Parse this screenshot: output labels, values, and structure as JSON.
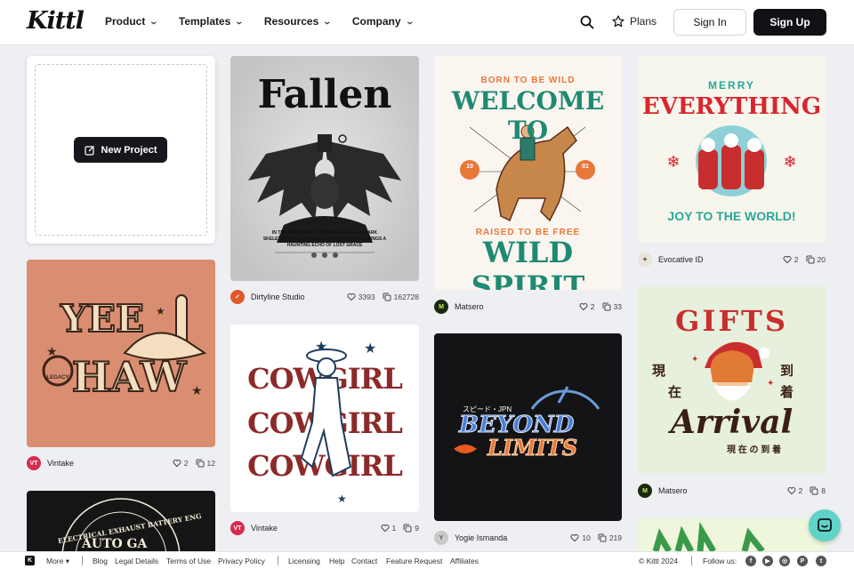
{
  "header": {
    "logo": "Kittl",
    "nav": [
      "Product",
      "Templates",
      "Resources",
      "Company"
    ],
    "plans": "Plans",
    "sign_in": "Sign In",
    "sign_up": "Sign Up"
  },
  "new_project": {
    "label": "New Project"
  },
  "cards": [
    {
      "author": "Dirtyline Studio",
      "likes": "3393",
      "copies": "162728"
    },
    {
      "author": "Matsero",
      "likes": "2",
      "copies": "33"
    },
    {
      "author": "Evocative ID",
      "likes": "2",
      "copies": "20"
    },
    {
      "author": "Vintake",
      "likes": "2",
      "copies": "12"
    },
    {
      "author": "Vintake",
      "likes": "1",
      "copies": "9"
    },
    {
      "author": "Yogie Ismanda",
      "likes": "10",
      "copies": "219"
    },
    {
      "author": "Matsero",
      "likes": "2",
      "copies": "8"
    }
  ],
  "designs": {
    "fallen_title": "Fallen",
    "fallen_caption": "IN THE SHADOWS OF DESPAIR, A FALLEN DARK SKELETON ANGEL EMERGES, ITS FRACTURED WINGS A HAUNTING ECHO OF LOST GRACE",
    "wild_top": "BORN TO BE WILD",
    "wild_welcome": "WELCOME TO",
    "wild_raised": "RAISED TO BE FREE",
    "wild_spirit": "WILD SPIRIT",
    "wild_19": "19",
    "wild_81": "81",
    "xmas_merry": "MERRY",
    "xmas_everything": "EVERYTHING",
    "xmas_joy": "JOY TO THE WORLD!",
    "yee": "YEE",
    "haw": "HAW",
    "legacy": "LEGACY",
    "cowgirl_rows": [
      "COWGIRL",
      "COWGIRL",
      "COWGIRL"
    ],
    "beyond_jp": "スピード・JPN",
    "beyond": "BEYOND",
    "limits": "LIMITS",
    "gifts": "GIFTS",
    "arrival": "Arrival",
    "arrival_jp_left1": "現",
    "arrival_jp_left2": "在",
    "arrival_jp_right1": "到",
    "arrival_jp_right2": "着",
    "arrival_jp_line": "現 在 の 到 着",
    "exhaust_arc": "ELECTRICAL EXHAUST BATTERY ENG",
    "exhaust_mid": "AUTO GA"
  },
  "footer": {
    "more": "More",
    "links": [
      "Blog",
      "Legal Details",
      "Terms of Use",
      "Privacy Policy",
      "Licensing",
      "Help",
      "Contact",
      "Feature Request",
      "Affiliates"
    ],
    "copyright": "© Kittl 2024",
    "follow": "Follow us:"
  },
  "colors": {
    "accent_dark": "#0f1115",
    "chat": "#5fd3c8",
    "teal": "#1f8a72",
    "orange": "#e8773a",
    "red": "#d8262f"
  }
}
